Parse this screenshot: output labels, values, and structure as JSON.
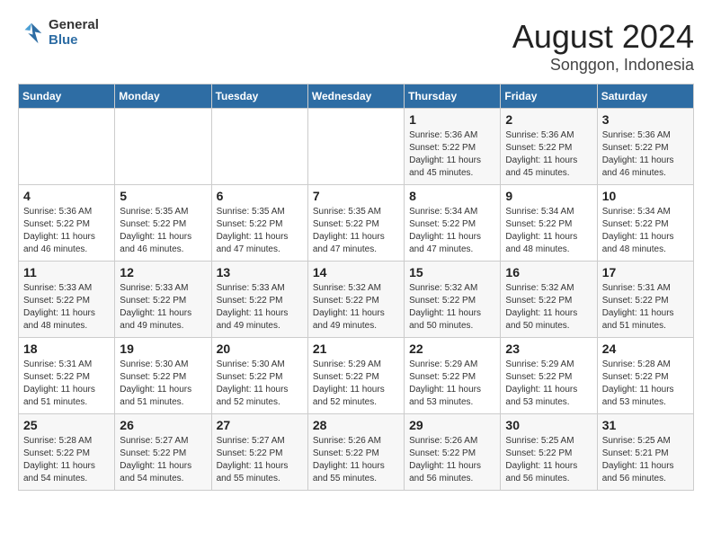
{
  "header": {
    "logo_line1": "General",
    "logo_line2": "Blue",
    "title": "August 2024",
    "subtitle": "Songgon, Indonesia"
  },
  "weekdays": [
    "Sunday",
    "Monday",
    "Tuesday",
    "Wednesday",
    "Thursday",
    "Friday",
    "Saturday"
  ],
  "weeks": [
    [
      {
        "day": "",
        "info": ""
      },
      {
        "day": "",
        "info": ""
      },
      {
        "day": "",
        "info": ""
      },
      {
        "day": "",
        "info": ""
      },
      {
        "day": "1",
        "info": "Sunrise: 5:36 AM\nSunset: 5:22 PM\nDaylight: 11 hours\nand 45 minutes."
      },
      {
        "day": "2",
        "info": "Sunrise: 5:36 AM\nSunset: 5:22 PM\nDaylight: 11 hours\nand 45 minutes."
      },
      {
        "day": "3",
        "info": "Sunrise: 5:36 AM\nSunset: 5:22 PM\nDaylight: 11 hours\nand 46 minutes."
      }
    ],
    [
      {
        "day": "4",
        "info": "Sunrise: 5:36 AM\nSunset: 5:22 PM\nDaylight: 11 hours\nand 46 minutes."
      },
      {
        "day": "5",
        "info": "Sunrise: 5:35 AM\nSunset: 5:22 PM\nDaylight: 11 hours\nand 46 minutes."
      },
      {
        "day": "6",
        "info": "Sunrise: 5:35 AM\nSunset: 5:22 PM\nDaylight: 11 hours\nand 47 minutes."
      },
      {
        "day": "7",
        "info": "Sunrise: 5:35 AM\nSunset: 5:22 PM\nDaylight: 11 hours\nand 47 minutes."
      },
      {
        "day": "8",
        "info": "Sunrise: 5:34 AM\nSunset: 5:22 PM\nDaylight: 11 hours\nand 47 minutes."
      },
      {
        "day": "9",
        "info": "Sunrise: 5:34 AM\nSunset: 5:22 PM\nDaylight: 11 hours\nand 48 minutes."
      },
      {
        "day": "10",
        "info": "Sunrise: 5:34 AM\nSunset: 5:22 PM\nDaylight: 11 hours\nand 48 minutes."
      }
    ],
    [
      {
        "day": "11",
        "info": "Sunrise: 5:33 AM\nSunset: 5:22 PM\nDaylight: 11 hours\nand 48 minutes."
      },
      {
        "day": "12",
        "info": "Sunrise: 5:33 AM\nSunset: 5:22 PM\nDaylight: 11 hours\nand 49 minutes."
      },
      {
        "day": "13",
        "info": "Sunrise: 5:33 AM\nSunset: 5:22 PM\nDaylight: 11 hours\nand 49 minutes."
      },
      {
        "day": "14",
        "info": "Sunrise: 5:32 AM\nSunset: 5:22 PM\nDaylight: 11 hours\nand 49 minutes."
      },
      {
        "day": "15",
        "info": "Sunrise: 5:32 AM\nSunset: 5:22 PM\nDaylight: 11 hours\nand 50 minutes."
      },
      {
        "day": "16",
        "info": "Sunrise: 5:32 AM\nSunset: 5:22 PM\nDaylight: 11 hours\nand 50 minutes."
      },
      {
        "day": "17",
        "info": "Sunrise: 5:31 AM\nSunset: 5:22 PM\nDaylight: 11 hours\nand 51 minutes."
      }
    ],
    [
      {
        "day": "18",
        "info": "Sunrise: 5:31 AM\nSunset: 5:22 PM\nDaylight: 11 hours\nand 51 minutes."
      },
      {
        "day": "19",
        "info": "Sunrise: 5:30 AM\nSunset: 5:22 PM\nDaylight: 11 hours\nand 51 minutes."
      },
      {
        "day": "20",
        "info": "Sunrise: 5:30 AM\nSunset: 5:22 PM\nDaylight: 11 hours\nand 52 minutes."
      },
      {
        "day": "21",
        "info": "Sunrise: 5:29 AM\nSunset: 5:22 PM\nDaylight: 11 hours\nand 52 minutes."
      },
      {
        "day": "22",
        "info": "Sunrise: 5:29 AM\nSunset: 5:22 PM\nDaylight: 11 hours\nand 53 minutes."
      },
      {
        "day": "23",
        "info": "Sunrise: 5:29 AM\nSunset: 5:22 PM\nDaylight: 11 hours\nand 53 minutes."
      },
      {
        "day": "24",
        "info": "Sunrise: 5:28 AM\nSunset: 5:22 PM\nDaylight: 11 hours\nand 53 minutes."
      }
    ],
    [
      {
        "day": "25",
        "info": "Sunrise: 5:28 AM\nSunset: 5:22 PM\nDaylight: 11 hours\nand 54 minutes."
      },
      {
        "day": "26",
        "info": "Sunrise: 5:27 AM\nSunset: 5:22 PM\nDaylight: 11 hours\nand 54 minutes."
      },
      {
        "day": "27",
        "info": "Sunrise: 5:27 AM\nSunset: 5:22 PM\nDaylight: 11 hours\nand 55 minutes."
      },
      {
        "day": "28",
        "info": "Sunrise: 5:26 AM\nSunset: 5:22 PM\nDaylight: 11 hours\nand 55 minutes."
      },
      {
        "day": "29",
        "info": "Sunrise: 5:26 AM\nSunset: 5:22 PM\nDaylight: 11 hours\nand 56 minutes."
      },
      {
        "day": "30",
        "info": "Sunrise: 5:25 AM\nSunset: 5:22 PM\nDaylight: 11 hours\nand 56 minutes."
      },
      {
        "day": "31",
        "info": "Sunrise: 5:25 AM\nSunset: 5:21 PM\nDaylight: 11 hours\nand 56 minutes."
      }
    ]
  ]
}
